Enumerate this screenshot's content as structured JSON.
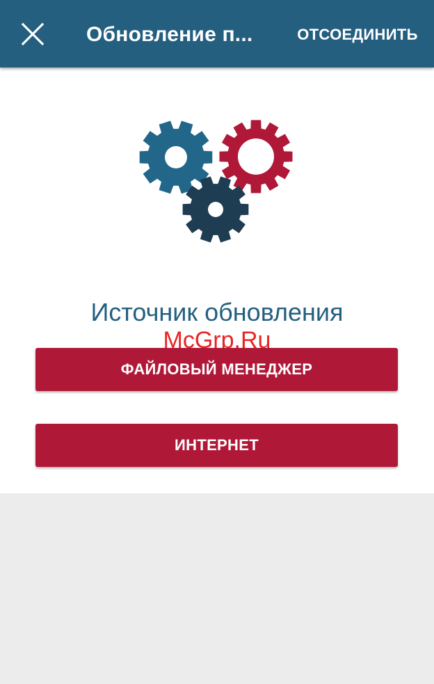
{
  "appbar": {
    "title": "Обновление п...",
    "disconnect_label": "ОТСОЕДИНИТЬ",
    "close_icon": "close-icon",
    "background_color": "#245f7f"
  },
  "main": {
    "illustration_icon": "gears-icon",
    "gear_colors": [
      "#22668a",
      "#b01838",
      "#1e3c52"
    ],
    "heading": "Источник обновления",
    "buttons": [
      {
        "label": "ФАЙЛОВЫЙ МЕНЕДЖЕР"
      },
      {
        "label": "ИНТЕРНЕТ"
      }
    ],
    "button_color": "#b01838"
  },
  "watermark": "McGrp.Ru"
}
